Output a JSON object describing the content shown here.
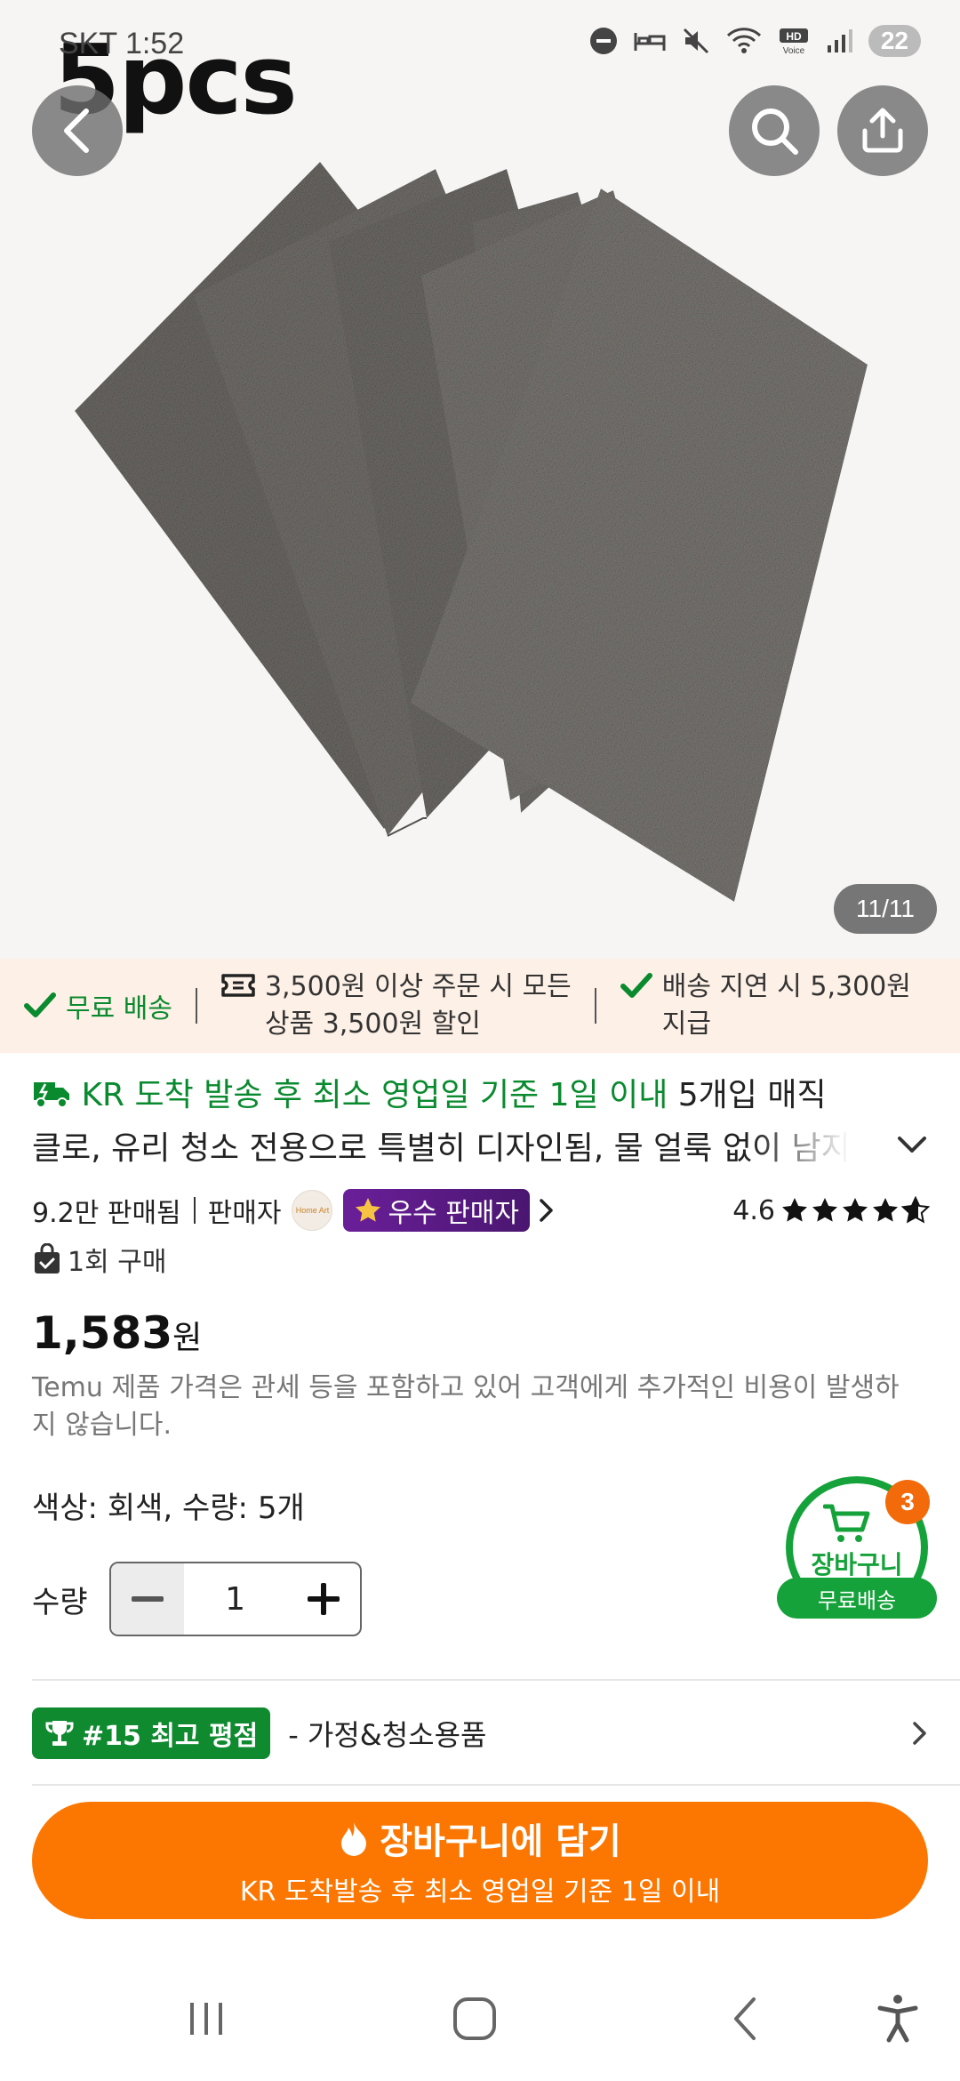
{
  "status_bar": {
    "time": "SKT 1:52",
    "battery": "22"
  },
  "hero": {
    "overlay_text": "5pcs",
    "image_counter": "11/11",
    "image_subject": "five gray cleaning cloths fanned out"
  },
  "promo_strip": {
    "items": [
      {
        "text": "무료 배송"
      },
      {
        "line1": "3,500원 이상 주문 시 모든",
        "line2": "상품 3,500원 할인"
      },
      {
        "line1": "배송 지연 시 5,300원",
        "line2": "지급"
      }
    ]
  },
  "product": {
    "shipping_highlight": "KR 도착 발송 후 최소 영업일 기준 1일 이내",
    "title_line1_rest": " 5개입 매직",
    "title_line2": "클로, 유리 청소 전용으로 특별히 디자인됨, 물 얼룩 없이 남지",
    "sold_count": "9.2만 판매됨",
    "seller_label": "판매자",
    "seller_avatar_text": "Home Art",
    "star_seller_label": "우수 판매자",
    "rating": "4.6",
    "purchase_count": "1회 구매",
    "price": "1,583",
    "currency": "원",
    "price_note": "Temu 제품 가격은 관세 등을 포함하고 있어 고객에게 추가적인 비용이 발생하지 않습니다.",
    "variant": "색상: 회색, 수량: 5개",
    "quantity_label": "수량",
    "quantity_value": "1"
  },
  "cart_float": {
    "badge": "3",
    "label": "장바구니",
    "pill": "무료배송"
  },
  "ranking": {
    "badge": "#15 최고 평점",
    "category": "- 가정&청소용품"
  },
  "cta": {
    "main": "장바구니에 담기",
    "sub": "KR 도착발송 후 최소 영업일 기준 1일 이내"
  },
  "colors": {
    "accent_orange": "#fb7701",
    "green": "#0a8a2f",
    "star_seller_purple": "#5a1a85",
    "promo_bg": "#fdf0e6"
  }
}
